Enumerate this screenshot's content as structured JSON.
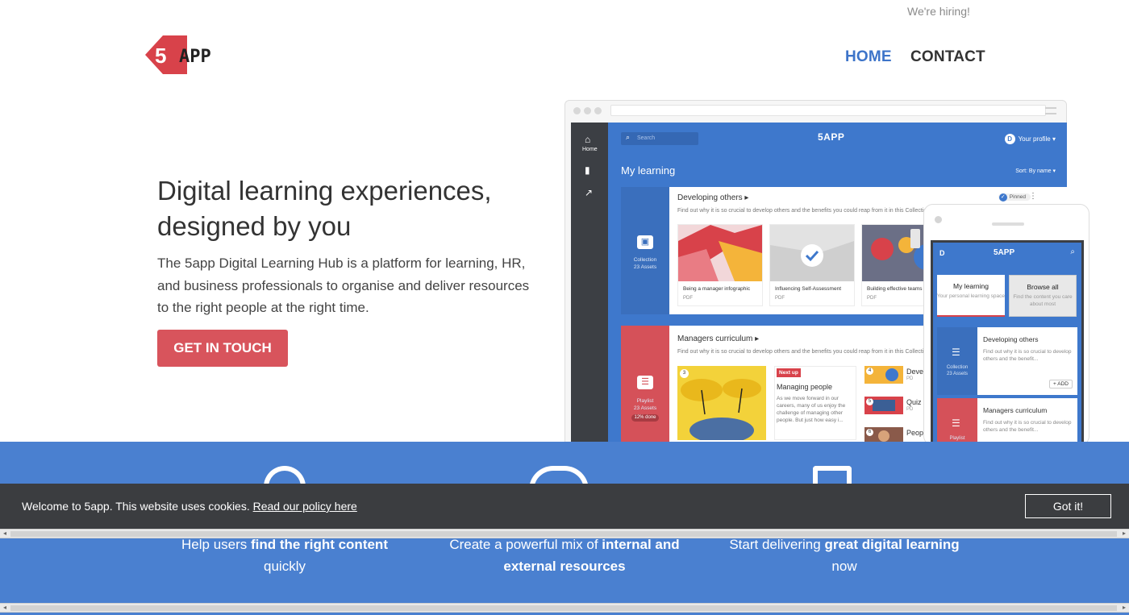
{
  "header": {
    "hiring": "We're hiring!",
    "logo_text": "5APP",
    "nav": [
      "HOME",
      "CONTACT"
    ],
    "nav_active_color": "#3d74c9"
  },
  "hero": {
    "title_line1": "Digital learning experiences,",
    "title_line2": "designed by you",
    "description": "The 5app Digital Learning Hub is a platform for learning, HR, and business professionals to organise and deliver resources to the right people at the right time.",
    "cta": "GET IN TOUCH",
    "cta_color": "#d8545c"
  },
  "mockup": {
    "rail": {
      "home_label": "Home"
    },
    "app": {
      "search_placeholder": "Search",
      "logo": "5APP",
      "profile_initial": "D",
      "profile_label": "Your profile ▾",
      "heading": "My learning",
      "sort": "Sort: By name ▾",
      "collection": {
        "title": "Developing others ▸",
        "description": "Find out why it is so crucial to develop others and the benefits you could reap from it in this Collection",
        "pinned": "Pinned",
        "side_label": "Collection",
        "side_count": "23 Assets",
        "tiles": [
          {
            "label": "Being a manager infographic",
            "type": "PDF"
          },
          {
            "label": "Influencing Self-Assessment",
            "type": "PDF"
          },
          {
            "label": "Building effective teams",
            "type": "PDF"
          }
        ]
      },
      "playlist": {
        "title": "Managers curriculum ▸",
        "description": "Find out why it is so crucial to develop others and the benefits you could reap from it in this Collection",
        "side_label": "Playlist",
        "side_count": "23 Assets",
        "progress": "12% done",
        "big_num": "3",
        "next_badge": "Next up",
        "next_title": "Managing people",
        "next_desc": "As we move forward in our careers, many of us enjoy the challenge of managing other people. But just how easy i...",
        "minis": [
          {
            "num": "4",
            "label": "Deve",
            "sub": "PD"
          },
          {
            "num": "5",
            "label": "Quiz",
            "sub": "PD"
          },
          {
            "num": "6",
            "label": "Peop",
            "sub": ""
          }
        ]
      }
    },
    "phone": {
      "initial": "D",
      "logo": "5APP",
      "tabs": [
        {
          "title": "My learning",
          "sub": "Your personal learning space"
        },
        {
          "title": "Browse all",
          "sub": "Find the content you care about most"
        }
      ],
      "cards": [
        {
          "title": "Developing others",
          "desc": "Find out why it is so crucial to develop others and the benefit...",
          "side": "Collection",
          "count": "23 Assets",
          "action": "+ ADD"
        },
        {
          "title": "Managers curriculum",
          "desc": "Find out why it is so crucial to develop others and the benefit...",
          "side": "Playlist",
          "count": ""
        }
      ]
    }
  },
  "features": [
    {
      "pre": "Help users ",
      "bold": "find the right content",
      "post": " quickly"
    },
    {
      "pre": "Create a powerful mix of ",
      "bold": "internal and external resources",
      "post": ""
    },
    {
      "pre": "Start delivering ",
      "bold": "great digital learning",
      "post": " now"
    }
  ],
  "cookie": {
    "text": "Welcome to 5app. This website uses cookies.",
    "link": "Read our policy here",
    "button": "Got it!"
  },
  "colors": {
    "band": "#4a80d0",
    "cookie_bg": "#3b3d40",
    "accent_red": "#d8545c"
  }
}
